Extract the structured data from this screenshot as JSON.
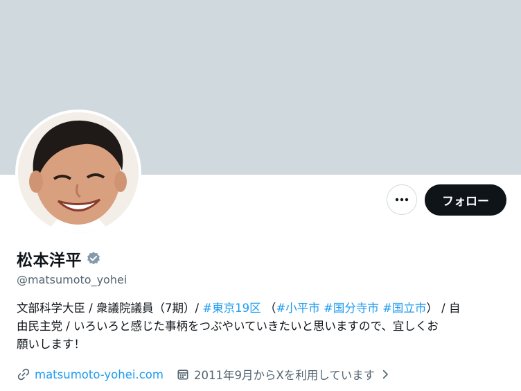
{
  "profile": {
    "name": "松本洋平",
    "handle": "@matsumoto_yohei",
    "follow_label": "フォロー",
    "bio": {
      "line1_text": "文部科学大臣 / 衆議院議員（7期）/ ",
      "tag1": "#東京19区",
      "paren_open": " （",
      "tag2": "#小平市",
      "tag3": "#国分寺市",
      "tag4": "#国立市",
      "line1_end": "） / 自",
      "line2": "由民主党 / いろいろと感じた事柄をつぶやいていきたいと思いますので、宜しくお",
      "line3": "願いします！"
    },
    "website": "matsumoto-yohei.com",
    "joined": "2011年9月からXを利用しています"
  },
  "colors": {
    "banner": "#cfd9de",
    "accent": "#1d9bf0",
    "text": "#0f1419",
    "secondary": "#536471",
    "verified": "#829aab"
  },
  "icons": [
    "more-icon",
    "verified-badge-icon",
    "link-icon",
    "calendar-icon",
    "chevron-right-icon"
  ]
}
